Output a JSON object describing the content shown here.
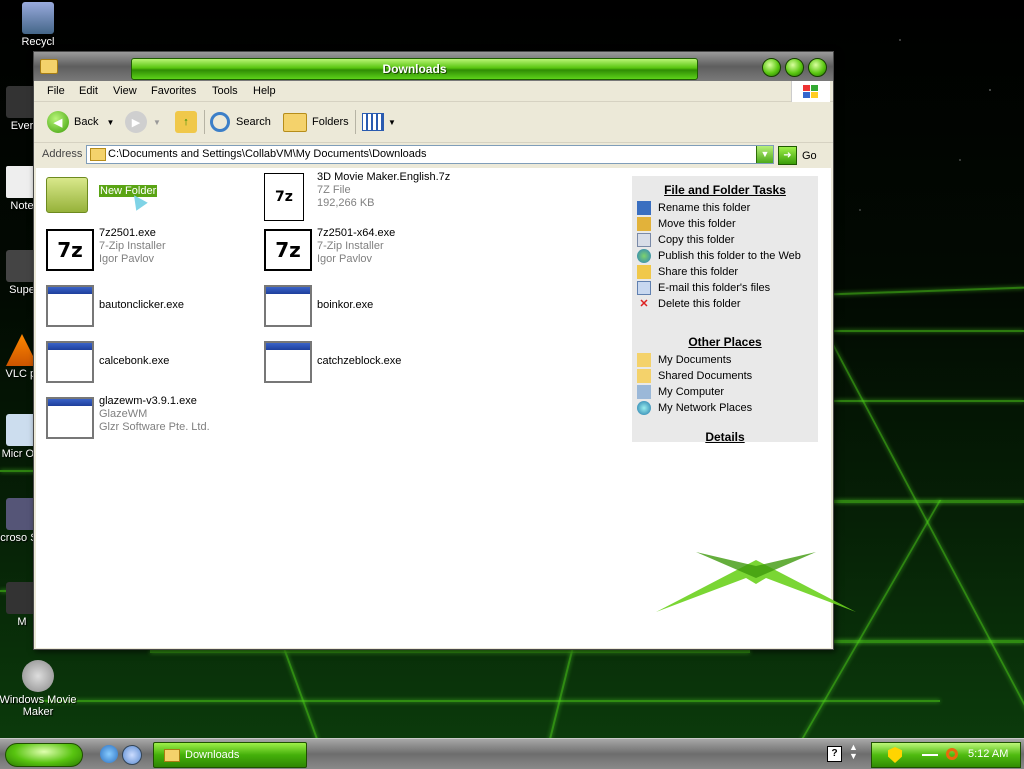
{
  "window": {
    "title": "Downloads"
  },
  "menu": [
    "File",
    "Edit",
    "View",
    "Favorites",
    "Tools",
    "Help"
  ],
  "toolbar": {
    "back": "Back",
    "search": "Search",
    "folders": "Folders"
  },
  "address": {
    "label": "Address",
    "value": "C:\\Documents and Settings\\CollabVM\\My Documents\\Downloads",
    "go": "Go"
  },
  "files": [
    {
      "name": "New Folder",
      "line2": "",
      "line3": "",
      "icon": "folder-icon"
    },
    {
      "name": "3D Movie Maker.English.7z",
      "line2": "7Z File",
      "line3": "192,266 KB",
      "icon": "7z-file-icon"
    },
    {
      "name": "7z2501.exe",
      "line2": "7-Zip Installer",
      "line3": "Igor Pavlov",
      "icon": "7zip-icon"
    },
    {
      "name": "7z2501-x64.exe",
      "line2": "7-Zip Installer",
      "line3": "Igor Pavlov",
      "icon": "7zip-icon"
    },
    {
      "name": "bautonclicker.exe",
      "line2": "",
      "line3": "",
      "icon": "exe-icon"
    },
    {
      "name": "boinkor.exe",
      "line2": "",
      "line3": "",
      "icon": "exe-icon"
    },
    {
      "name": "calcebonk.exe",
      "line2": "",
      "line3": "",
      "icon": "exe-icon"
    },
    {
      "name": "catchzeblock.exe",
      "line2": "",
      "line3": "",
      "icon": "exe-icon"
    },
    {
      "name": "glazewm-v3.9.1.exe",
      "line2": "GlazeWM",
      "line3": "Glzr Software Pte. Ltd.",
      "icon": "exe-icon"
    }
  ],
  "tasks": {
    "file_folder_title": "File and Folder Tasks",
    "file_folder": [
      "Rename this folder",
      "Move this folder",
      "Copy this folder",
      "Publish this folder to the Web",
      "Share this folder",
      "E-mail this folder's files",
      "Delete this folder"
    ],
    "other_title": "Other Places",
    "other": [
      "My Documents",
      "Shared Documents",
      "My Computer",
      "My Network Places"
    ],
    "details_title": "Details"
  },
  "desktop_icons": [
    "Recycl",
    "Ever",
    "Note",
    "Supe",
    "VLC pl",
    "Micr Offi",
    "Microso Studi",
    "M",
    "Windows Movie Maker"
  ],
  "taskbar": {
    "task": "Downloads",
    "clock": "5:12 AM"
  },
  "colors": {
    "accent": "#4fbb10",
    "titlebar_green": "#57c40e"
  }
}
